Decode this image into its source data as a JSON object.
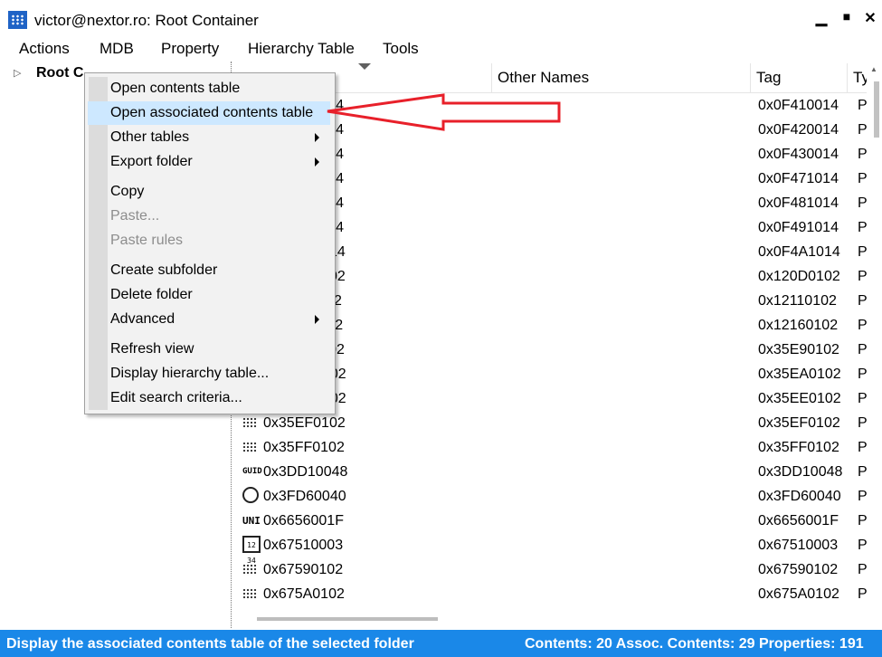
{
  "window": {
    "title": "victor@nextor.ro: Root Container",
    "minimize_label": "▁",
    "maximize_label": "■",
    "close_label": "✕"
  },
  "menubar": [
    "Actions",
    "MDB",
    "Property",
    "Hierarchy Table",
    "Tools"
  ],
  "tree": {
    "root_label": "Root Container",
    "root_visible_label": "Root C"
  },
  "table": {
    "columns": [
      "Other Names",
      "Tag",
      "Ty"
    ],
    "rows": [
      {
        "name": "0x0F410014",
        "tag": "0x0F410014",
        "type": "P",
        "icon": "binary-icon"
      },
      {
        "name": "0x0F420014",
        "tag": "0x0F420014",
        "type": "P",
        "icon": "binary-icon"
      },
      {
        "name": "0x0F430014",
        "tag": "0x0F430014",
        "type": "P",
        "icon": "binary-icon"
      },
      {
        "name": "0x0F470014",
        "tag": "0x0F471014",
        "type": "P",
        "icon": "binary-icon"
      },
      {
        "name": "0x0F480014",
        "tag": "0x0F481014",
        "type": "P",
        "icon": "binary-icon"
      },
      {
        "name": "0x0F490014",
        "tag": "0x0F491014",
        "type": "P",
        "icon": "binary-icon"
      },
      {
        "name": "0x0F4A0014",
        "tag": "0x0F4A1014",
        "type": "P",
        "icon": "binary-icon"
      },
      {
        "name": "0x120D0102",
        "tag": "0x120D0102",
        "type": "P",
        "icon": "binary-icon"
      },
      {
        "name": "0x12110102",
        "tag": "0x12110102",
        "type": "P",
        "icon": "binary-icon"
      },
      {
        "name": "0x12160102",
        "tag": "0x12160102",
        "type": "P",
        "icon": "binary-icon"
      },
      {
        "name": "0x35E90102",
        "tag": "0x35E90102",
        "type": "P",
        "icon": "binary-icon"
      },
      {
        "name": "0x35EA0102",
        "tag": "0x35EA0102",
        "type": "P",
        "icon": "binary-icon"
      },
      {
        "name": "0x35EE0102",
        "tag": "0x35EE0102",
        "type": "P",
        "icon": "binary-icon"
      },
      {
        "name": "0x35EF0102",
        "tag": "0x35EF0102",
        "type": "P",
        "icon": "binary-icon"
      },
      {
        "name": "0x35FF0102",
        "tag": "0x35FF0102",
        "type": "P",
        "icon": "binary-icon"
      },
      {
        "name": "0x3DD10048",
        "tag": "0x3DD10048",
        "type": "P",
        "icon": "guid-icon"
      },
      {
        "name": "0x3FD60040",
        "tag": "0x3FD60040",
        "type": "P",
        "icon": "clock-icon"
      },
      {
        "name": "0x6656001F",
        "tag": "0x6656001F",
        "type": "P",
        "icon": "unicode-icon"
      },
      {
        "name": "0x67510003",
        "tag": "0x67510003",
        "type": "P",
        "icon": "integer-icon"
      },
      {
        "name": "0x67590102",
        "tag": "0x67590102",
        "type": "P",
        "icon": "binary-icon"
      },
      {
        "name": "0x675A0102",
        "tag": "0x675A0102",
        "type": "P",
        "icon": "binary-icon"
      }
    ],
    "icon_text": {
      "guid": "GUID",
      "unicode": "UNI",
      "integer": "12 34"
    }
  },
  "context_menu": {
    "items": [
      {
        "label": "Open contents table",
        "enabled": true,
        "submenu": false
      },
      {
        "label": "Open associated contents table",
        "enabled": true,
        "submenu": false,
        "highlighted": true
      },
      {
        "label": "Other tables",
        "enabled": true,
        "submenu": true
      },
      {
        "label": "Export folder",
        "enabled": true,
        "submenu": true
      },
      {
        "label": "Copy",
        "enabled": true,
        "submenu": false
      },
      {
        "label": "Paste...",
        "enabled": false,
        "submenu": false
      },
      {
        "label": "Paste rules",
        "enabled": false,
        "submenu": false
      },
      {
        "label": "Create subfolder",
        "enabled": true,
        "submenu": false
      },
      {
        "label": "Delete folder",
        "enabled": true,
        "submenu": false
      },
      {
        "label": "Advanced",
        "enabled": true,
        "submenu": true
      },
      {
        "label": "Refresh view",
        "enabled": true,
        "submenu": false
      },
      {
        "label": "Display hierarchy table...",
        "enabled": true,
        "submenu": false
      },
      {
        "label": "Edit search criteria...",
        "enabled": true,
        "submenu": false
      }
    ]
  },
  "annotation": {
    "arrow_color": "#e8202a"
  },
  "status": {
    "left": "Display the associated contents table of the selected folder",
    "right": "Contents: 20 Assoc. Contents: 29  Properties: 191"
  },
  "colors": {
    "statusbar": "#1a88e8",
    "menu_highlight": "#cde8ff",
    "app_icon": "#1f63c6"
  }
}
